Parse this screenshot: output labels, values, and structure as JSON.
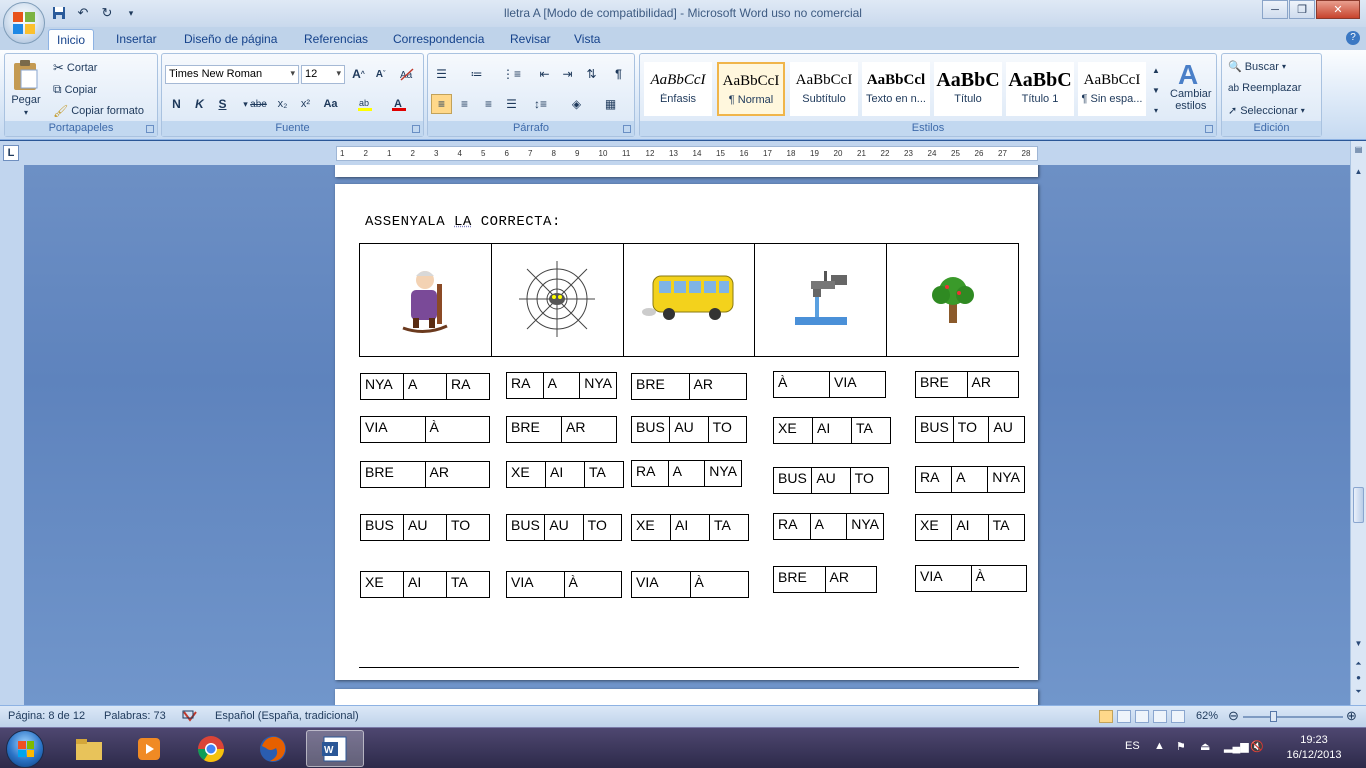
{
  "window": {
    "title": "lletra A [Modo de compatibilidad] - Microsoft Word uso no comercial",
    "minimize": "─",
    "maximize": "❐",
    "close": "✕"
  },
  "tabs": [
    "Inicio",
    "Insertar",
    "Diseño de página",
    "Referencias",
    "Correspondencia",
    "Revisar",
    "Vista"
  ],
  "ribbon": {
    "clipboard": {
      "label": "Portapapeles",
      "paste": "Pegar",
      "cut": "Cortar",
      "copy": "Copiar",
      "format_painter": "Copiar formato"
    },
    "font": {
      "label": "Fuente",
      "font_name": "Times New Roman",
      "font_size": "12",
      "bold": "N",
      "italic": "K",
      "underline": "S",
      "strike": "abe",
      "subscript": "x₂",
      "superscript": "x²",
      "change_case": "Aa",
      "grow": "A",
      "shrink": "A"
    },
    "paragraph": {
      "label": "Párrafo"
    },
    "styles": {
      "label": "Estilos",
      "tiles": [
        {
          "preview": "AaBbCcI",
          "name": "Énfasis"
        },
        {
          "preview": "AaBbCcI",
          "name": "¶ Normal"
        },
        {
          "preview": "AaBbCcI",
          "name": "Subtítulo"
        },
        {
          "preview": "AaBbCcl",
          "name": "Texto en n..."
        },
        {
          "preview": "AaBbC",
          "name": "Título"
        },
        {
          "preview": "AaBbC",
          "name": "Título 1"
        },
        {
          "preview": "AaBbCcI",
          "name": "¶ Sin espa..."
        }
      ],
      "change_styles": "Cambiar",
      "change_styles_2": "estilos"
    },
    "editing": {
      "label": "Edición",
      "find": "Buscar",
      "replace": "Reemplazar",
      "select": "Seleccionar"
    }
  },
  "ruler": {
    "tab_selector": "L",
    "numbers": [
      "1",
      "2",
      "1",
      "2",
      "3",
      "4",
      "5",
      "6",
      "7",
      "8",
      "9",
      "10",
      "11",
      "12",
      "13",
      "14",
      "15",
      "16",
      "17",
      "18",
      "19",
      "20",
      "21",
      "22",
      "23",
      "24",
      "25",
      "26",
      "27",
      "28"
    ]
  },
  "document": {
    "heading_part1": "ASSENYALA ",
    "heading_part2": "LA",
    "heading_part3": " CORRECTA:",
    "pictures": [
      "grandmother-rocking-chair",
      "spider-web",
      "bus",
      "water-tap",
      "tree"
    ],
    "word_options": [
      [
        [
          "NYA",
          "A",
          "RA"
        ],
        [
          "RA",
          "A",
          "NYA"
        ],
        [
          "BRE",
          "AR"
        ],
        [
          "À",
          "VIA"
        ],
        [
          "BRE",
          "AR"
        ]
      ],
      [
        [
          "VIA",
          "À"
        ],
        [
          "BRE",
          "AR"
        ],
        [
          "BUS",
          "AU",
          "TO"
        ],
        [
          "XE",
          "AI",
          "TA"
        ],
        [
          "BUS",
          "TO",
          "AU"
        ]
      ],
      [
        [
          "BRE",
          "AR"
        ],
        [
          "XE",
          "AI",
          "TA"
        ],
        [
          "RA",
          "A",
          "NYA"
        ],
        [
          "BUS",
          "AU",
          "TO"
        ],
        [
          "RA",
          "A",
          "NYA"
        ]
      ],
      [
        [
          "BUS",
          "AU",
          "TO"
        ],
        [
          "BUS",
          "AU",
          "TO"
        ],
        [
          "XE",
          "AI",
          "TA"
        ],
        [
          "RA",
          "A",
          "NYA"
        ],
        [
          "XE",
          "AI",
          "TA"
        ]
      ],
      [
        [
          "XE",
          "AI",
          "TA"
        ],
        [
          "VIA",
          "À"
        ],
        [
          "VIA",
          "À"
        ],
        [
          "BRE",
          "AR"
        ],
        [
          "VIA",
          "À"
        ]
      ]
    ]
  },
  "statusbar": {
    "page": "Página: 8 de 12",
    "words": "Palabras: 73",
    "language": "Español (España, tradicional)",
    "zoom": "62%",
    "zoom_level": 0.62
  },
  "taskbar": {
    "lang": "ES",
    "time": "19:23",
    "date": "16/12/2013"
  },
  "colors": {
    "ribbon_bg": "#dbe8f7",
    "doc_bg": "#6d90c5",
    "accent": "#15428b"
  }
}
